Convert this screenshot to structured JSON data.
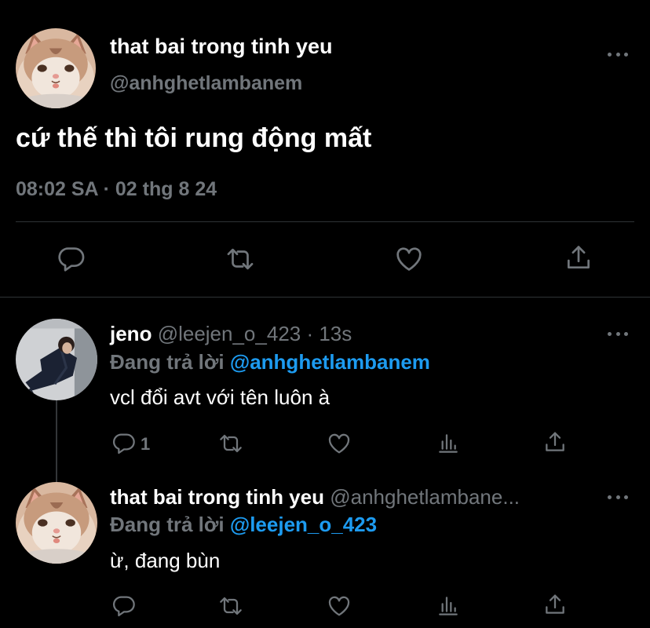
{
  "main_tweet": {
    "display_name": "that bai trong tinh yeu",
    "handle": "@anhghetlambanem",
    "text": "cứ thế thì tôi rung động mất",
    "timestamp": "08:02 SA · 02 thg 8 24"
  },
  "replies": [
    {
      "display_name": "jeno",
      "handle": "@leejen_o_423",
      "age": "· 13s",
      "replying_prefix": "Đang trả lời",
      "replying_to": "@anhghetlambanem",
      "text": "vcl đổi avt với tên luôn à",
      "reply_count": "1"
    },
    {
      "display_name": "that bai trong tinh yeu",
      "handle": "@anhghetlambane...",
      "replying_prefix": "Đang trả lời",
      "replying_to": "@leejen_o_423",
      "text": "ừ, đang bùn"
    }
  ],
  "icons": {
    "reply": "reply-icon",
    "retweet": "retweet-icon",
    "like": "heart-icon",
    "share": "share-icon",
    "analytics": "analytics-icon",
    "more": "more-icon"
  },
  "colors": {
    "background": "#000000",
    "text": "#e7e9ea",
    "muted": "#71767b",
    "link": "#1d9bf0",
    "divider": "#2f3336"
  }
}
